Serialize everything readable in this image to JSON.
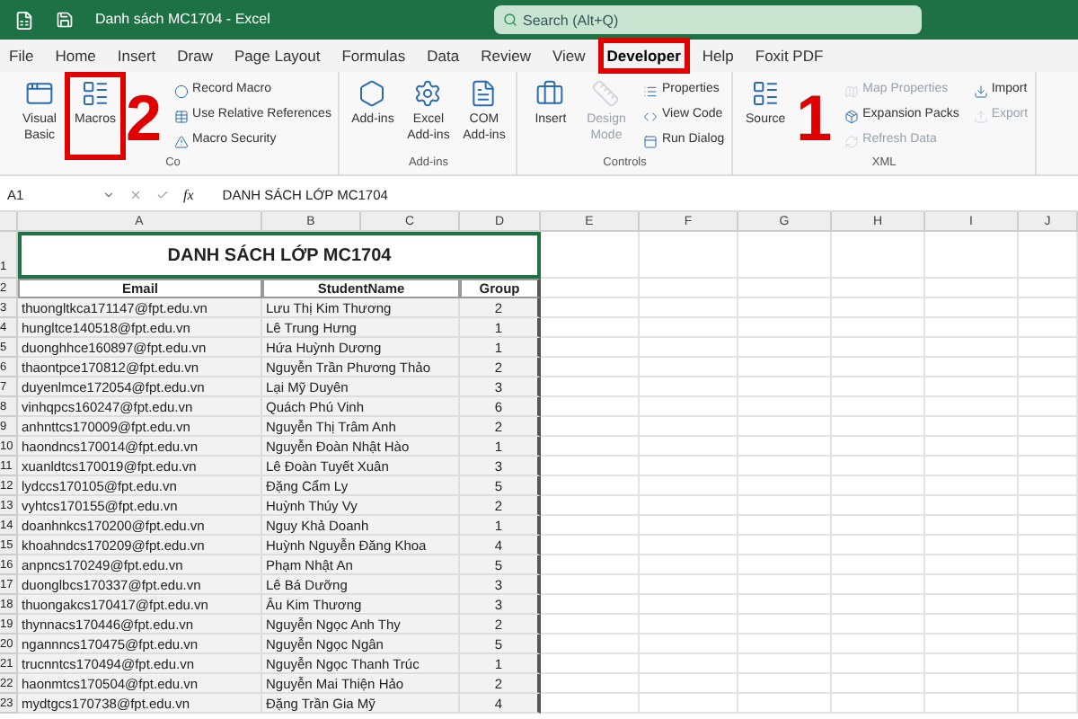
{
  "window": {
    "title": "Danh sách MC1704  -  Excel",
    "search_placeholder": "Search (Alt+Q)"
  },
  "tabs": [
    {
      "label": "File",
      "selected": false,
      "framed": false
    },
    {
      "label": "Home",
      "selected": false,
      "framed": false
    },
    {
      "label": "Insert",
      "selected": false,
      "framed": false
    },
    {
      "label": "Draw",
      "selected": false,
      "framed": false
    },
    {
      "label": "Page Layout",
      "selected": false,
      "framed": false
    },
    {
      "label": "Formulas",
      "selected": false,
      "framed": false
    },
    {
      "label": "Data",
      "selected": false,
      "framed": false
    },
    {
      "label": "Review",
      "selected": false,
      "framed": false
    },
    {
      "label": "View",
      "selected": false,
      "framed": false
    },
    {
      "label": "Developer",
      "selected": true,
      "framed": true
    },
    {
      "label": "Help",
      "selected": false,
      "framed": false
    },
    {
      "label": "Foxit PDF",
      "selected": false,
      "framed": false
    }
  ],
  "ribbon_groups": [
    {
      "label": "Co",
      "step_number": "2",
      "big": [
        {
          "label": "Visual Basic",
          "disabled": false,
          "framed": false
        },
        {
          "label": "Macros",
          "disabled": false,
          "framed": true
        }
      ],
      "small": [
        {
          "label": "Record Macro",
          "disabled": false
        },
        {
          "label": "Use Relative References",
          "disabled": false
        },
        {
          "label": "Macro Security",
          "disabled": false
        }
      ]
    },
    {
      "label": "Add-ins",
      "big": [
        {
          "label": "Add-ins",
          "disabled": false,
          "framed": false
        },
        {
          "label": "Excel Add-ins",
          "disabled": false,
          "framed": false
        },
        {
          "label": "COM Add-ins",
          "disabled": false,
          "framed": false
        }
      ]
    },
    {
      "label": "Controls",
      "big": [
        {
          "label": "Insert",
          "disabled": false,
          "framed": false
        },
        {
          "label": "Design Mode",
          "disabled": true,
          "framed": false
        }
      ],
      "small": [
        {
          "label": "Properties",
          "disabled": false
        },
        {
          "label": "View Code",
          "disabled": false
        },
        {
          "label": "Run Dialog",
          "disabled": false
        }
      ]
    },
    {
      "label": "XML",
      "step_number": "1",
      "big": [
        {
          "label": "Source",
          "disabled": false,
          "framed": false
        }
      ],
      "small": [
        {
          "label": "Map Properties",
          "disabled": true
        },
        {
          "label": "Expansion Packs",
          "disabled": false
        },
        {
          "label": "Refresh Data",
          "disabled": true
        },
        {
          "label": "Import",
          "disabled": false
        },
        {
          "label": "Export",
          "disabled": true
        }
      ]
    }
  ],
  "formula_bar": {
    "cell": "A1",
    "fx": "fx",
    "value": "DANH SÁCH LỚP MC1704"
  },
  "sheet": {
    "columns": [
      "A",
      "B",
      "C",
      "D",
      "E",
      "F",
      "G",
      "H",
      "I",
      "J"
    ],
    "title_row": {
      "number": "1",
      "text": "DANH SÁCH LỚP MC1704"
    },
    "header_row": {
      "number": "2",
      "cells": [
        "Email",
        "StudentName",
        "Group"
      ]
    },
    "rows": [
      {
        "number": "3",
        "email": "thuongltkca171147@fpt.edu.vn",
        "name": "Lưu Thị Kim Thương",
        "group": "2"
      },
      {
        "number": "4",
        "email": "hungltce140518@fpt.edu.vn",
        "name": "Lê Trung Hưng",
        "group": "1"
      },
      {
        "number": "5",
        "email": "duonghhce160897@fpt.edu.vn",
        "name": "Hứa Huỳnh Dương",
        "group": "1"
      },
      {
        "number": "6",
        "email": "thaontpce170812@fpt.edu.vn",
        "name": "Nguyễn Trần Phương Thảo",
        "group": "2"
      },
      {
        "number": "7",
        "email": "duyenlmce172054@fpt.edu.vn",
        "name": "Lại Mỹ Duyên",
        "group": "3"
      },
      {
        "number": "8",
        "email": "vinhqpcs160247@fpt.edu.vn",
        "name": "Quách Phú Vinh",
        "group": "6"
      },
      {
        "number": "9",
        "email": "anhnttcs170009@fpt.edu.vn",
        "name": "Nguyễn Thị Trâm Anh",
        "group": "2"
      },
      {
        "number": "10",
        "email": "haondncs170014@fpt.edu.vn",
        "name": "Nguyễn Đoàn Nhật Hào",
        "group": "1"
      },
      {
        "number": "11",
        "email": "xuanldtcs170019@fpt.edu.vn",
        "name": "Lê Đoàn Tuyết Xuân",
        "group": "3"
      },
      {
        "number": "12",
        "email": "lydccs170105@fpt.edu.vn",
        "name": "Đặng Cẩm Ly",
        "group": "5"
      },
      {
        "number": "13",
        "email": "vyhtcs170155@fpt.edu.vn",
        "name": "Huỳnh Thúy Vy",
        "group": "2"
      },
      {
        "number": "14",
        "email": "doanhnkcs170200@fpt.edu.vn",
        "name": "Nguy Khả Doanh",
        "group": "1"
      },
      {
        "number": "15",
        "email": "khoahndcs170209@fpt.edu.vn",
        "name": "Huỳnh Nguyễn Đăng Khoa",
        "group": "4"
      },
      {
        "number": "16",
        "email": "anpncs170249@fpt.edu.vn",
        "name": "Phạm Nhật An",
        "group": "5"
      },
      {
        "number": "17",
        "email": "duonglbcs170337@fpt.edu.vn",
        "name": "Lê Bá Dưỡng",
        "group": "3"
      },
      {
        "number": "18",
        "email": "thuongakcs170417@fpt.edu.vn",
        "name": "Âu Kim Thương",
        "group": "3"
      },
      {
        "number": "19",
        "email": "thynnacs170446@fpt.edu.vn",
        "name": "Nguyễn Ngọc Anh Thy",
        "group": "2"
      },
      {
        "number": "20",
        "email": "ngannncs170475@fpt.edu.vn",
        "name": "Nguyễn Ngọc Ngân",
        "group": "5"
      },
      {
        "number": "21",
        "email": "trucnntcs170494@fpt.edu.vn",
        "name": "Nguyễn Ngọc Thanh Trúc",
        "group": "1"
      },
      {
        "number": "22",
        "email": "haonmtcs170504@fpt.edu.vn",
        "name": "Nguyễn Mai Thiện Hảo",
        "group": "2"
      },
      {
        "number": "23",
        "email": "mydtgcs170738@fpt.edu.vn",
        "name": "Đặng Trần Gia Mỹ",
        "group": "4"
      }
    ]
  }
}
